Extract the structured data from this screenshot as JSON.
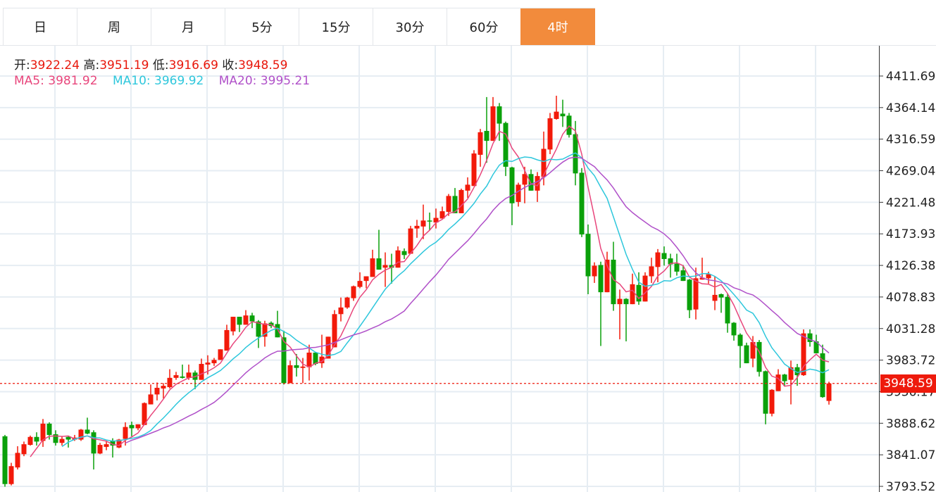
{
  "tabs": [
    {
      "label": "日",
      "active": false
    },
    {
      "label": "周",
      "active": false
    },
    {
      "label": "月",
      "active": false
    },
    {
      "label": "5分",
      "active": false
    },
    {
      "label": "15分",
      "active": false
    },
    {
      "label": "30分",
      "active": false
    },
    {
      "label": "60分",
      "active": false
    },
    {
      "label": "4时",
      "active": true
    }
  ],
  "ohlc_info": {
    "open_label": "开:",
    "open": "3922.24",
    "high_label": "高:",
    "high": "3951.19",
    "low_label": "低:",
    "low": "3916.69",
    "close_label": "收:",
    "close": "3948.59"
  },
  "ma_info": {
    "ma5_label": "MA5:",
    "ma5": "3981.92",
    "ma10_label": "MA10:",
    "ma10": "3969.92",
    "ma20_label": "MA20:",
    "ma20": "3995.21"
  },
  "last_price_tag": "3948.59",
  "colors": {
    "up": "#f21a0a",
    "down": "#0aa00a",
    "ma5": "#e8467c",
    "ma10": "#2ec7dc",
    "ma20": "#b051c9",
    "active_tab": "#f28b3c"
  },
  "chart_data": {
    "type": "candlestick",
    "up_color_convention": "red up, green down",
    "yaxis": {
      "position": "right",
      "range": [
        3793.52,
        4411.69
      ],
      "ticks": [
        "4411.69",
        "4364.14",
        "4316.59",
        "4269.04",
        "4221.48",
        "4173.93",
        "4126.38",
        "4078.83",
        "4031.28",
        "3983.72",
        "3936.17",
        "3888.62",
        "3841.07",
        "3793.52"
      ]
    },
    "grid": true,
    "last_price_line": 3948.59,
    "moving_averages": [
      5,
      10,
      20
    ],
    "ohlc": [
      [
        3869,
        3871,
        3793,
        3797
      ],
      [
        3797,
        3829,
        3795,
        3824
      ],
      [
        3822,
        3854,
        3819,
        3844
      ],
      [
        3842,
        3861,
        3839,
        3857
      ],
      [
        3856,
        3870,
        3855,
        3868
      ],
      [
        3868,
        3875,
        3855,
        3861
      ],
      [
        3862,
        3895,
        3853,
        3888
      ],
      [
        3888,
        3890,
        3864,
        3871
      ],
      [
        3872,
        3878,
        3855,
        3859
      ],
      [
        3859,
        3869,
        3855,
        3865
      ],
      [
        3868,
        3869,
        3852,
        3864
      ],
      [
        3864,
        3871,
        3862,
        3867
      ],
      [
        3864,
        3880,
        3862,
        3879
      ],
      [
        3879,
        3897,
        3872,
        3873
      ],
      [
        3875,
        3878,
        3819,
        3843
      ],
      [
        3843,
        3859,
        3842,
        3856
      ],
      [
        3853,
        3862,
        3848,
        3857
      ],
      [
        3862,
        3866,
        3837,
        3855
      ],
      [
        3852,
        3865,
        3851,
        3864
      ],
      [
        3865,
        3890,
        3855,
        3883
      ],
      [
        3886,
        3891,
        3869,
        3881
      ],
      [
        3881,
        3887,
        3878,
        3887
      ],
      [
        3886,
        3920,
        3886,
        3919
      ],
      [
        3917,
        3947,
        3917,
        3932
      ],
      [
        3932,
        3950,
        3923,
        3942
      ],
      [
        3941,
        3949,
        3926,
        3945
      ],
      [
        3943,
        3970,
        3941,
        3957
      ],
      [
        3957,
        3966,
        3954,
        3961
      ],
      [
        3959,
        3977,
        3956,
        3957
      ],
      [
        3957,
        3977,
        3954,
        3965
      ],
      [
        3965,
        3968,
        3940,
        3954
      ],
      [
        3954,
        3986,
        3954,
        3978
      ],
      [
        3977,
        3991,
        3962,
        3980
      ],
      [
        3979,
        3987,
        3975,
        3984
      ],
      [
        3984,
        4000,
        3984,
        4000
      ],
      [
        3998,
        4037,
        3998,
        4029
      ],
      [
        4027,
        4049,
        4021,
        4049
      ],
      [
        4049,
        4049,
        4026,
        4037
      ],
      [
        4037,
        4059,
        4037,
        4051
      ],
      [
        4051,
        4055,
        4032,
        4042
      ],
      [
        4042,
        4044,
        4002,
        4019
      ],
      [
        4019,
        4043,
        4004,
        4039
      ],
      [
        4040,
        4042,
        4032,
        4035
      ],
      [
        4038,
        4058,
        4018,
        4018
      ],
      [
        4018,
        4028,
        3947,
        3949
      ],
      [
        3949,
        3983,
        3949,
        3976
      ],
      [
        3976,
        3993,
        3959,
        3972
      ],
      [
        3972,
        3987,
        3949,
        3974
      ],
      [
        3973,
        4007,
        3953,
        3995
      ],
      [
        3995,
        3996,
        3976,
        3978
      ],
      [
        3979,
        4022,
        3972,
        3989
      ],
      [
        3986,
        4019,
        3986,
        4019
      ],
      [
        4003,
        4059,
        4003,
        4053
      ],
      [
        4053,
        4078,
        4042,
        4063
      ],
      [
        4063,
        4079,
        4061,
        4078
      ],
      [
        4077,
        4096,
        4073,
        4095
      ],
      [
        4094,
        4116,
        4092,
        4103
      ],
      [
        4103,
        4110,
        4092,
        4110
      ],
      [
        4109,
        4150,
        4109,
        4137
      ],
      [
        4137,
        4180,
        4120,
        4120
      ],
      [
        4123,
        4146,
        4094,
        4127
      ],
      [
        4127,
        4144,
        4099,
        4123
      ],
      [
        4123,
        4155,
        4123,
        4149
      ],
      [
        4148,
        4152,
        4136,
        4142
      ],
      [
        4144,
        4186,
        4144,
        4182
      ],
      [
        4182,
        4195,
        4168,
        4186
      ],
      [
        4185,
        4218,
        4166,
        4194
      ],
      [
        4194,
        4206,
        4179,
        4193
      ],
      [
        4191,
        4212,
        4182,
        4198
      ],
      [
        4197,
        4215,
        4197,
        4208
      ],
      [
        4207,
        4234,
        4201,
        4231
      ],
      [
        4231,
        4243,
        4205,
        4205
      ],
      [
        4205,
        4242,
        4205,
        4240
      ],
      [
        4239,
        4259,
        4228,
        4248
      ],
      [
        4246,
        4300,
        4246,
        4295
      ],
      [
        4293,
        4332,
        4275,
        4327
      ],
      [
        4329,
        4380,
        4281,
        4314
      ],
      [
        4314,
        4380,
        4314,
        4366
      ],
      [
        4366,
        4371,
        4314,
        4340
      ],
      [
        4341,
        4343,
        4261,
        4275
      ],
      [
        4274,
        4275,
        4187,
        4220
      ],
      [
        4222,
        4251,
        4215,
        4248
      ],
      [
        4248,
        4275,
        4220,
        4264
      ],
      [
        4264,
        4271,
        4239,
        4239
      ],
      [
        4239,
        4267,
        4222,
        4261
      ],
      [
        4260,
        4328,
        4247,
        4302
      ],
      [
        4301,
        4356,
        4294,
        4348
      ],
      [
        4347,
        4382,
        4346,
        4358
      ],
      [
        4355,
        4376,
        4335,
        4351
      ],
      [
        4352,
        4356,
        4319,
        4323
      ],
      [
        4324,
        4344,
        4247,
        4265
      ],
      [
        4266,
        4273,
        4169,
        4173
      ],
      [
        4174,
        4188,
        4083,
        4110
      ],
      [
        4110,
        4131,
        4100,
        4126
      ],
      [
        4127,
        4132,
        4005,
        4086
      ],
      [
        4086,
        4147,
        4086,
        4135
      ],
      [
        4135,
        4162,
        4058,
        4068
      ],
      [
        4068,
        4090,
        4015,
        4076
      ],
      [
        4076,
        4077,
        4012,
        4068
      ],
      [
        4068,
        4114,
        4068,
        4098
      ],
      [
        4097,
        4116,
        4067,
        4072
      ],
      [
        4072,
        4116,
        4072,
        4111
      ],
      [
        4110,
        4138,
        4100,
        4125
      ],
      [
        4124,
        4151,
        4101,
        4146
      ],
      [
        4145,
        4155,
        4126,
        4136
      ],
      [
        4137,
        4144,
        4108,
        4128
      ],
      [
        4129,
        4144,
        4111,
        4117
      ],
      [
        4119,
        4127,
        4103,
        4103
      ],
      [
        4105,
        4106,
        4047,
        4059
      ],
      [
        4060,
        4123,
        4045,
        4107
      ],
      [
        4105,
        4138,
        4105,
        4108
      ],
      [
        4107,
        4117,
        4099,
        4113
      ],
      [
        4073,
        4110,
        4059,
        4082
      ],
      [
        4083,
        4084,
        4055,
        4078
      ],
      [
        4079,
        4084,
        4025,
        4039
      ],
      [
        4040,
        4041,
        4013,
        4021
      ],
      [
        4022,
        4024,
        3972,
        4005
      ],
      [
        4006,
        4010,
        3979,
        3979
      ],
      [
        3986,
        4020,
        3973,
        4011
      ],
      [
        4011,
        4014,
        3959,
        3966
      ],
      [
        3967,
        3968,
        3887,
        3903
      ],
      [
        3903,
        3940,
        3899,
        3939
      ],
      [
        3937,
        3970,
        3937,
        3962
      ],
      [
        3962,
        3963,
        3945,
        3952
      ],
      [
        3954,
        3983,
        3917,
        3973
      ],
      [
        3973,
        3978,
        3945,
        3961
      ],
      [
        3961,
        4030,
        3960,
        4024
      ],
      [
        4024,
        4030,
        4004,
        4011
      ],
      [
        4012,
        4022,
        3994,
        3994
      ],
      [
        3994,
        4007,
        3927,
        3928
      ],
      [
        3922.24,
        3951.19,
        3916.69,
        3948.59
      ]
    ]
  }
}
